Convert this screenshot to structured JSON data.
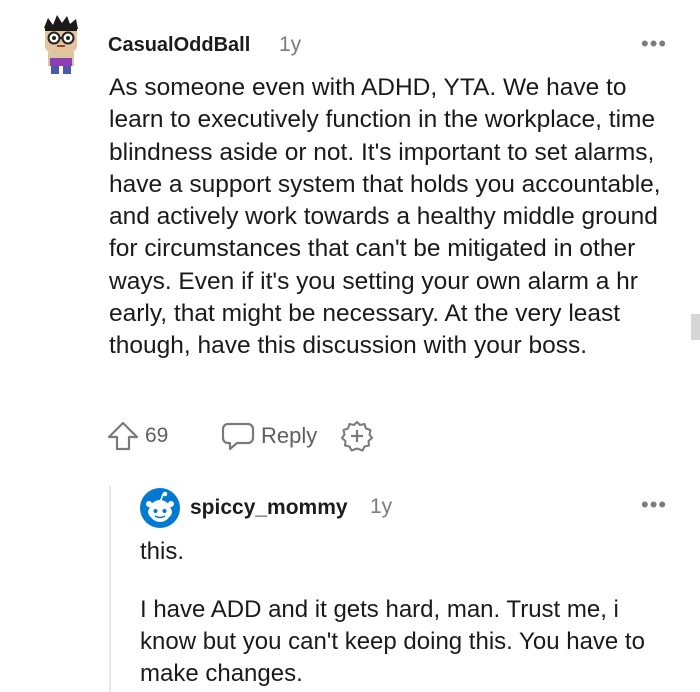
{
  "comment": {
    "username": "CasualOddBall",
    "age": "1y",
    "more": "•••",
    "body": "As someone even with ADHD, YTA. We have to learn to executively function in the workplace, time blindness aside or not. It's important to set alarms, have a support system that holds you accountable, and actively work towards a healthy middle ground for circumstances that can't be mitigated in other ways. Even if it's you setting your own alarm a hr early, that might be necessary. At the very least though, have this discussion with your boss.",
    "score": "69",
    "reply_label": "Reply"
  },
  "reply": {
    "username": "spiccy_mommy",
    "age": "1y",
    "more": "•••",
    "paragraph1": "this.",
    "paragraph2": "I have ADD and it gets hard, man. Trust me, i know but you can't keep doing this. You have to make changes."
  },
  "icons": {
    "upvote": "arrow-up-outline-icon",
    "reply": "speech-bubble-icon",
    "award": "award-plus-icon",
    "more": "more-horizontal-icon"
  },
  "colors": {
    "text": "#1a1a1b",
    "meta": "#7c7c7c",
    "action": "#5f5f5f",
    "snoo_blue": "#0079d3"
  }
}
